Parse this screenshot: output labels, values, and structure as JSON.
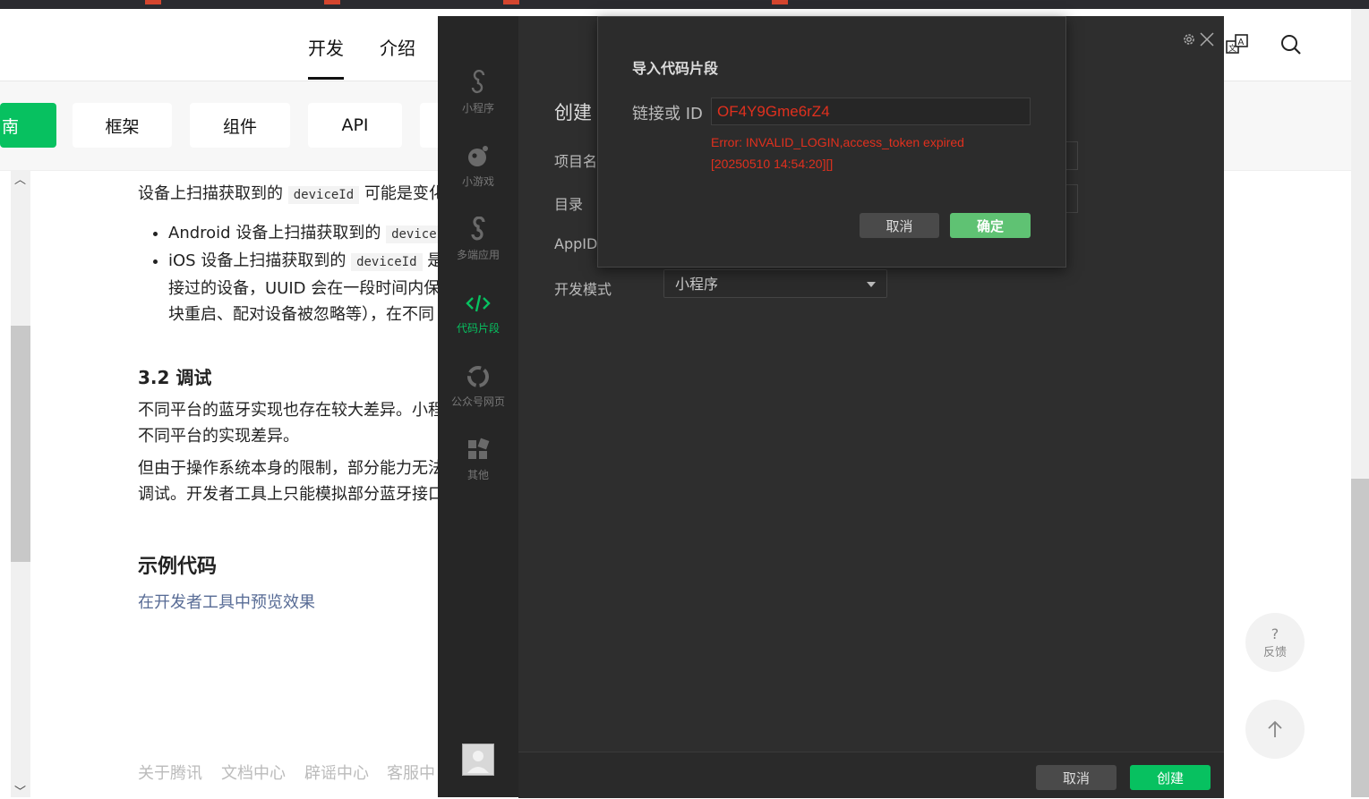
{
  "header": {
    "tabs": [
      "开发",
      "介绍"
    ]
  },
  "subnav": {
    "chips": [
      "南",
      "框架",
      "组件",
      "API"
    ]
  },
  "doc": {
    "para1_a": "设备上扫描获取到的",
    "para1_code": "deviceId",
    "para1_b": "可能是变化",
    "bullet1_a": "Android 设备上扫描获取到的",
    "bullet1_code": "deviceI",
    "bullet2_a": "iOS 设备上扫描获取到的",
    "bullet2_code": "deviceId",
    "bullet2_b": "是",
    "bullet2_line2": "接过的设备，UUID 会在一段时间内保",
    "bullet2_line3": "块重启、配对设备被忽略等），在不同",
    "section_3_2": "3.2 调试",
    "para2_line1": "不同平台的蓝牙实现也存在较大差异。小程",
    "para2_line2": "不同平台的实现差异。",
    "para3_line1": "但由于操作系统本身的限制，部分能力无法",
    "para3_line2": "调试。开发者工具上只能模拟部分蓝牙接口",
    "example_title": "示例代码",
    "preview_link": "在开发者工具中预览效果"
  },
  "footer": {
    "links": [
      "关于腾讯",
      "文档中心",
      "辟谣中心",
      "客服中"
    ]
  },
  "float": {
    "feedback_glyph": "?",
    "feedback_label": "反馈"
  },
  "devtool": {
    "sidebar": [
      {
        "label": "小程序",
        "icon": "miniprogram-icon"
      },
      {
        "label": "小游戏",
        "icon": "minigame-icon"
      },
      {
        "label": "多端应用",
        "icon": "multiplatform-icon"
      },
      {
        "label": "代码片段",
        "icon": "code-snippet-icon",
        "active": true
      },
      {
        "label": "公众号网页",
        "icon": "official-account-icon"
      },
      {
        "label": "其他",
        "icon": "other-icon"
      }
    ],
    "title": "创建",
    "labels": {
      "project_name": "项目名",
      "directory": "目录",
      "appid": "AppID",
      "dev_mode": "开发模式"
    },
    "dev_mode_value": "小程序",
    "footer_cancel": "取消",
    "footer_create": "创建"
  },
  "modal": {
    "title": "导入代码片段",
    "label": "链接或 ID",
    "input_value": "OF4Y9Gme6rZ4",
    "error_line1": "Error: INVALID_LOGIN,access_token expired",
    "error_line2": "[20250510 14:54:20][]",
    "cancel": "取消",
    "confirm": "确定"
  },
  "colors": {
    "accent_green": "#07c160",
    "error_red": "#e0301e",
    "link_blue": "#576b95"
  }
}
